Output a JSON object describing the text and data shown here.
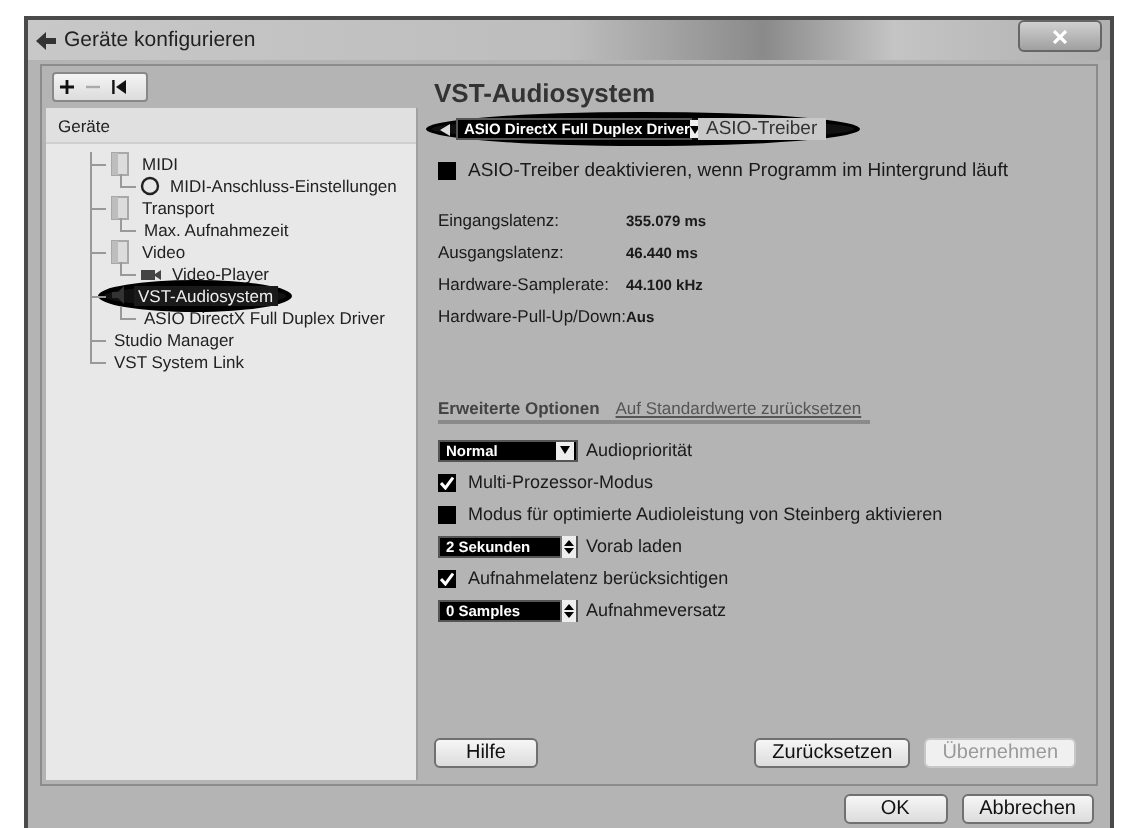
{
  "window": {
    "title": "Geräte konfigurieren"
  },
  "tree": {
    "header": "Geräte",
    "items": [
      {
        "label": "MIDI",
        "kind": "folder",
        "selected": false,
        "circled": false,
        "children": [
          {
            "label": "MIDI-Anschluss-Einstellungen",
            "kind": "port",
            "selected": false,
            "circled": false
          }
        ]
      },
      {
        "label": "Transport",
        "kind": "folder",
        "selected": false,
        "circled": false,
        "children": [
          {
            "label": "Max. Aufnahmezeit",
            "kind": "plain",
            "selected": false,
            "circled": false
          }
        ]
      },
      {
        "label": "Video",
        "kind": "folder",
        "selected": false,
        "circled": false,
        "children": [
          {
            "label": "Video-Player",
            "kind": "video",
            "selected": false,
            "circled": false
          }
        ]
      },
      {
        "label": "VST-Audiosystem",
        "kind": "audio",
        "selected": true,
        "circled": true,
        "children": [
          {
            "label": "ASIO DirectX Full Duplex Driver",
            "kind": "plain",
            "selected": false,
            "circled": false
          }
        ]
      },
      {
        "label": "Studio Manager",
        "kind": "plain",
        "selected": false,
        "circled": false
      },
      {
        "label": "VST System Link",
        "kind": "plain",
        "selected": false,
        "circled": false
      }
    ]
  },
  "page": {
    "title": "VST-Audiosystem",
    "driver": {
      "value": "ASIO DirectX Full Duplex Driver",
      "label": "ASIO-Treiber",
      "circled": true
    },
    "background_option": {
      "label": "ASIO-Treiber deaktivieren, wenn Programm im Hintergrund läuft",
      "checked": false
    },
    "info": [
      {
        "label": "Eingangslatenz:",
        "value": "355.079 ms"
      },
      {
        "label": "Ausgangslatenz:",
        "value": "46.440 ms"
      },
      {
        "label": "Hardware-Samplerate:",
        "value": "44.100 kHz"
      },
      {
        "label": "Hardware-Pull-Up/Down:",
        "value": "Aus"
      }
    ],
    "section": {
      "title": "Erweiterte Optionen",
      "link": "Auf Standardwerte zurücksetzen"
    },
    "options": [
      {
        "kind": "dropdown",
        "selection": "Normal",
        "label": "Audiopriorität"
      },
      {
        "kind": "checkbox",
        "checked": true,
        "label": "Multi-Prozessor-Modus"
      },
      {
        "kind": "checkbox",
        "checked": false,
        "label": "Modus für optimierte Audioleistung von Steinberg aktivieren"
      },
      {
        "kind": "spinner",
        "selection": "2 Sekunden",
        "label": "Vorab laden"
      },
      {
        "kind": "checkbox",
        "checked": true,
        "label": "Aufnahmelatenz berücksichtigen"
      },
      {
        "kind": "spinner",
        "selection": "0 Samples",
        "label": "Aufnahmeversatz"
      }
    ],
    "help_button": "Hilfe",
    "panel_buttons": [
      {
        "label": "Zurücksetzen",
        "disabled": false
      },
      {
        "label": "Übernehmen",
        "disabled": true
      }
    ]
  },
  "dialog_buttons": [
    {
      "label": "OK",
      "disabled": false
    },
    {
      "label": "Abbrechen",
      "disabled": false
    }
  ]
}
